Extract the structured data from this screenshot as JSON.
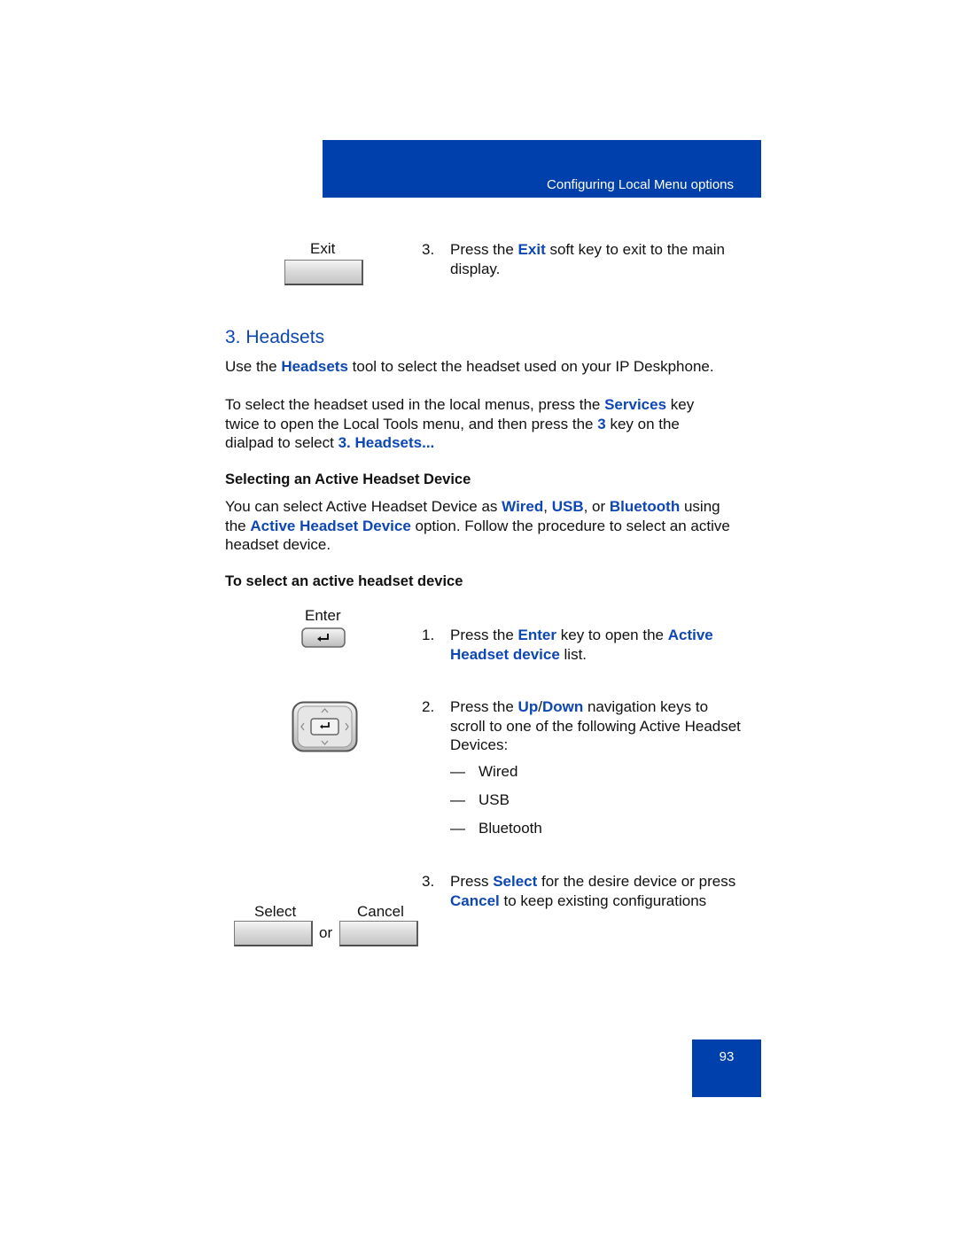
{
  "header": {
    "section_title": "Configuring Local Menu options"
  },
  "exit_step": {
    "key_label": "Exit",
    "number": "3.",
    "parts": [
      "Press the ",
      "Exit",
      " soft key to exit to the main display."
    ]
  },
  "section": {
    "heading": "3. Headsets",
    "intro": [
      "Use the ",
      "Headsets",
      " tool to select the headset used on your IP Deskphone."
    ],
    "instructions": [
      "To select the headset used in the local menus, press the ",
      "Services",
      " key twice to open the Local Tools menu, and then press the ",
      "3",
      " key on the dialpad to select ",
      "3. Headsets..."
    ],
    "subheading": "Selecting an Active Headset Device",
    "description": [
      "You can select Active Headset Device as ",
      "Wired",
      ", ",
      "USB",
      ", or ",
      "Bluetooth",
      " using the ",
      "Active Headset Device",
      " option. Follow the procedure to select an active headset device."
    ],
    "procedure_title": "To select an active headset device"
  },
  "steps": [
    {
      "number": "1.",
      "key_label": "Enter",
      "key_icon": "enter-key-icon",
      "parts": [
        "Press the ",
        "Enter",
        " key to open the ",
        "Active Headset device",
        " list."
      ]
    },
    {
      "number": "2.",
      "key_icon": "navigation-cluster-icon",
      "parts": [
        "Press the ",
        "Up",
        "/",
        "Down",
        " navigation keys to scroll to one of the following Active Headset Devices:"
      ],
      "options": [
        {
          "dash": "—",
          "label": "Wired"
        },
        {
          "dash": "—",
          "label": "USB"
        },
        {
          "dash": "—",
          "label": "Bluetooth"
        }
      ]
    },
    {
      "number": "3.",
      "select_label": "Select",
      "cancel_label": "Cancel",
      "or_label": "or",
      "parts": [
        "Press ",
        "Select",
        " for the desire device or press ",
        "Cancel",
        " to keep existing configurations"
      ]
    }
  ],
  "footer": {
    "page_number": "93"
  },
  "colors": {
    "brand_blue": "#0040ac",
    "link_blue": "#0d47b3"
  }
}
